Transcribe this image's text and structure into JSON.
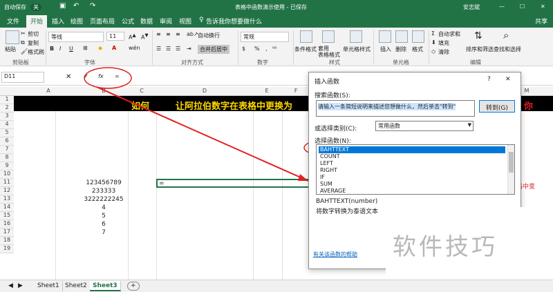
{
  "titlebar": {
    "autosave": "自动保存",
    "autosave_state": "关",
    "doc_title": "表格中函数演示使用 - 已保存",
    "user": "安志斌"
  },
  "tabs": [
    "文件",
    "开始",
    "插入",
    "绘图",
    "页面布局",
    "公式",
    "数据",
    "审阅",
    "视图"
  ],
  "tell_me": "告诉我你想要做什么",
  "share": "共享",
  "ribbon": {
    "clipboard": {
      "paste": "粘贴",
      "cut": "剪切",
      "copy": "复制",
      "format_painter": "格式刷",
      "label": "剪贴板"
    },
    "font": {
      "name": "等线",
      "size": "11",
      "bold": "B",
      "italic": "I",
      "underline": "U",
      "wen": "wén",
      "label": "字体"
    },
    "alignment": {
      "wrap": "自动换行",
      "merge": "合并后居中",
      "label": "对齐方式"
    },
    "number": {
      "format": "常规",
      "label": "数字"
    },
    "styles": {
      "cond": "条件格式",
      "table": "套用\n表格格式",
      "cell": "单元格样式",
      "label": "样式"
    },
    "cells": {
      "insert": "插入",
      "delete": "删除",
      "format": "格式",
      "label": "单元格"
    },
    "editing": {
      "autosum": "自动求和",
      "fill": "填充",
      "clear": "清除",
      "sort": "排序和筛选",
      "find": "查找和选择",
      "label": "编辑"
    }
  },
  "formula_bar": {
    "name_box": "D11",
    "cancel": "✕",
    "enter": "✓",
    "fx": "fx",
    "content": "="
  },
  "columns": [
    "A",
    "B",
    "C",
    "D",
    "E",
    "F",
    "M"
  ],
  "rows": [
    "1",
    "2",
    "3",
    "4",
    "5",
    "6",
    "7",
    "8",
    "9",
    "10",
    "11",
    "12",
    "13",
    "14",
    "15",
    "16",
    "17",
    "18",
    "19"
  ],
  "banner": {
    "left": "如何",
    "right": "让阿拉伯数字在表格中更换为",
    "edge": "你"
  },
  "cells_b": [
    "123456789",
    "233333",
    "3222222245",
    "4",
    "5",
    "6",
    "7"
  ],
  "active_cell_value": "=",
  "side_fragment": "格中变",
  "sheets": [
    "Sheet1",
    "Sheet2",
    "Sheet3"
  ],
  "add_sheet": "+",
  "dialog": {
    "title": "插入函数",
    "help": "?",
    "close": "✕",
    "search_label": "搜索函数(S):",
    "search_value": "请输入一条简短说明来描述您想做什么，然后单击\"转到\"",
    "go_button": "转到(G)",
    "category_label": "或选择类别(C):",
    "category_value": "常用函数",
    "select_label": "选择函数(N):",
    "functions": [
      "BAHTTEXT",
      "COUNT",
      "LEFT",
      "RIGHT",
      "IF",
      "SUM",
      "AVERAGE"
    ],
    "signature": "BAHTTEXT(number)",
    "description": "将数字转换为泰语文本",
    "help_link": "有关该函数的帮助"
  },
  "watermark": "软件技巧",
  "colors": {
    "excel_green": "#217346",
    "banner_bg": "#000000",
    "banner_text": "#ffd800",
    "annotation_red": "#e02020",
    "selection": "#0078d7"
  }
}
